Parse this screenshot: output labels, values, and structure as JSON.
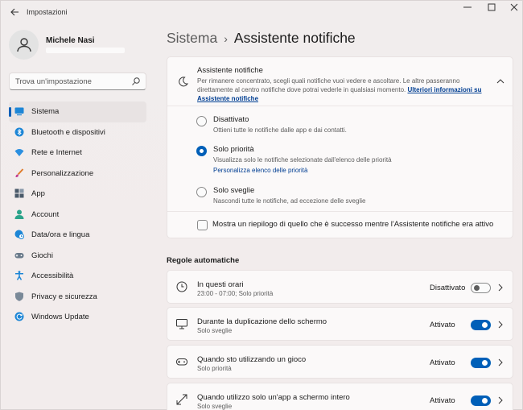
{
  "window": {
    "title": "Impostazioni",
    "back_icon": "back-arrow-icon",
    "minimize_icon": "minimize-icon",
    "maximize_icon": "maximize-icon",
    "close_icon": "close-icon"
  },
  "profile": {
    "name": "Michele Nasi"
  },
  "search": {
    "placeholder": "Trova un'impostazione"
  },
  "sidebar": {
    "items": [
      {
        "label": "Sistema",
        "icon": "system-icon",
        "active": true
      },
      {
        "label": "Bluetooth e dispositivi",
        "icon": "bluetooth-icon",
        "active": false
      },
      {
        "label": "Rete e Internet",
        "icon": "wifi-icon",
        "active": false
      },
      {
        "label": "Personalizzazione",
        "icon": "brush-icon",
        "active": false
      },
      {
        "label": "App",
        "icon": "apps-icon",
        "active": false
      },
      {
        "label": "Account",
        "icon": "account-icon",
        "active": false
      },
      {
        "label": "Data/ora e lingua",
        "icon": "globe-clock-icon",
        "active": false
      },
      {
        "label": "Giochi",
        "icon": "gamepad-icon",
        "active": false
      },
      {
        "label": "Accessibilità",
        "icon": "accessibility-icon",
        "active": false
      },
      {
        "label": "Privacy e sicurezza",
        "icon": "shield-icon",
        "active": false
      },
      {
        "label": "Windows Update",
        "icon": "update-icon",
        "active": false
      }
    ]
  },
  "breadcrumb": {
    "parent": "Sistema",
    "separator": "›",
    "current": "Assistente notifiche"
  },
  "focus_card": {
    "title": "Assistente notifiche",
    "description": "Per rimanere concentrato, scegli quali notifiche vuoi vedere e ascoltare. Le altre passeranno direttamente al centro notifiche dove potrai vederle in qualsiasi momento.",
    "link": "Ulteriori informazioni su Assistente notifiche",
    "options": [
      {
        "label": "Disattivato",
        "desc": "Ottieni tutte le notifiche dalle app e dai contatti.",
        "checked": false,
        "link": ""
      },
      {
        "label": "Solo priorità",
        "desc": "Visualizza solo le notifiche selezionate dall'elenco delle priorità",
        "checked": true,
        "link": "Personalizza elenco delle priorità"
      },
      {
        "label": "Solo sveglie",
        "desc": "Nascondi tutte le notifiche, ad eccezione delle sveglie",
        "checked": false,
        "link": ""
      }
    ],
    "summary_checkbox": {
      "label": "Mostra un riepilogo di quello che è successo mentre l'Assistente notifiche era attivo",
      "checked": false
    }
  },
  "rules": {
    "section_title": "Regole automatiche",
    "items": [
      {
        "title": "In questi orari",
        "subtitle": "23:00 - 07:00; Solo priorità",
        "status": "Disattivato",
        "on": false,
        "icon": "clock-icon"
      },
      {
        "title": "Durante la duplicazione dello schermo",
        "subtitle": "Solo sveglie",
        "status": "Attivato",
        "on": true,
        "icon": "monitor-icon"
      },
      {
        "title": "Quando sto utilizzando un gioco",
        "subtitle": "Solo priorità",
        "status": "Attivato",
        "on": true,
        "icon": "gamepad-icon"
      },
      {
        "title": "Quando utilizzo solo un'app a schermo intero",
        "subtitle": "Solo sveglie",
        "status": "Attivato",
        "on": true,
        "icon": "fullscreen-icon"
      }
    ]
  },
  "colors": {
    "accent": "#005fb8",
    "link": "#003e92",
    "background": "#f2eded",
    "card": "#fbf9f9"
  }
}
